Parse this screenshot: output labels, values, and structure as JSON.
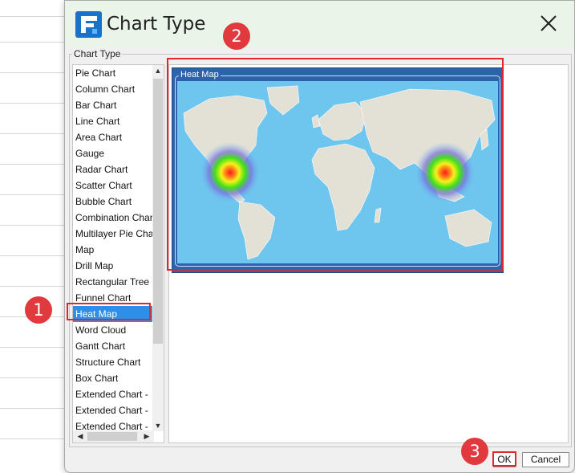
{
  "dialog": {
    "title": "Chart Type",
    "group_label": "Chart Type"
  },
  "chart_types": [
    "Pie Chart",
    "Column Chart",
    "Bar Chart",
    "Line Chart",
    "Area Chart",
    "Gauge",
    "Radar Chart",
    "Scatter Chart",
    "Bubble Chart",
    "Combination Chart",
    "Multilayer Pie Chart",
    "Map",
    "Drill Map",
    "Rectangular Tree",
    "Funnel Chart",
    "Heat Map",
    "Word Cloud",
    "Gantt Chart",
    "Structure Chart",
    "Box Chart",
    "Extended Chart -",
    "Extended Chart -",
    "Extended Chart -"
  ],
  "selected_index": 15,
  "preview": {
    "label": "Heat Map"
  },
  "buttons": {
    "ok": "OK",
    "cancel": "Cancel"
  },
  "annotations": [
    "1",
    "2",
    "3"
  ],
  "colors": {
    "accent_red": "#e3262b",
    "selection_blue": "#2f8ee8",
    "map_ocean": "#6ec6ee",
    "map_land": "#e3e0d6"
  },
  "icons": {
    "logo": "app-logo-icon",
    "close": "close-icon"
  }
}
